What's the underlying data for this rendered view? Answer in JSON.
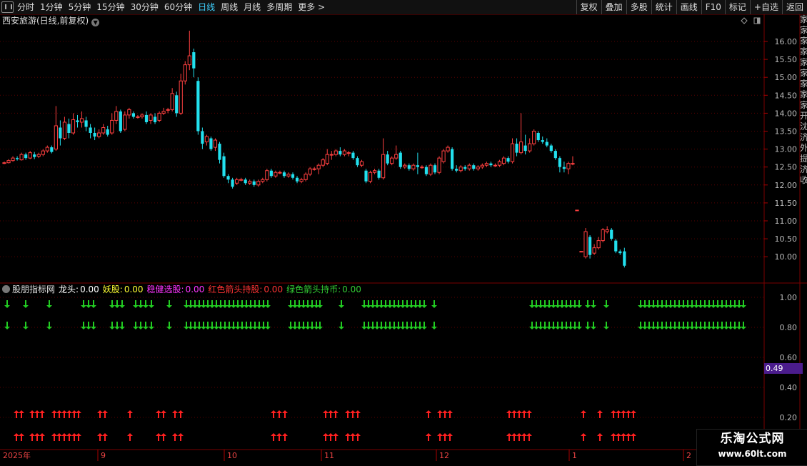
{
  "toolbar": {
    "periods": [
      "分时",
      "1分钟",
      "5分钟",
      "15分钟",
      "30分钟",
      "60分钟",
      "日线",
      "周线",
      "月线",
      "多周期",
      "更多 >"
    ],
    "active_period": "日线",
    "right_buttons": [
      "复权",
      "叠加",
      "多股",
      "统计",
      "画线",
      "F10",
      "标记",
      "+自选",
      "返回"
    ]
  },
  "main_panel": {
    "title": "西安旅游(日线,前复权)",
    "price_axis": [
      "16.00",
      "15.50",
      "15.00",
      "14.50",
      "14.00",
      "13.50",
      "13.00",
      "12.50",
      "12.00",
      "11.50",
      "11.00",
      "10.50",
      "10.00"
    ],
    "right_clipped_text": [
      "家",
      "家",
      "家",
      "家",
      "家",
      "家",
      "家",
      "家",
      "家",
      "开",
      "沈",
      "济",
      "外",
      "提",
      "济",
      "收"
    ]
  },
  "indicator_panel": {
    "name": "股朋指标网",
    "items": [
      {
        "label": "龙头:",
        "value": "0.00",
        "color": "#ffffff"
      },
      {
        "label": "妖股:",
        "value": "0.00",
        "color": "#ffff33"
      },
      {
        "label": "稳健选股:",
        "value": "0.00",
        "color": "#ff33ff"
      },
      {
        "label": "红色箭头持股:",
        "value": "0.00",
        "color": "#ff3333"
      },
      {
        "label": "绿色箭头持币:",
        "value": "0.00",
        "color": "#33cc33"
      }
    ],
    "axis": [
      "1.00",
      "0.80",
      "0.60",
      "0.40",
      "0.20"
    ],
    "current_value": "0.49"
  },
  "time_axis": [
    "2025年",
    "9",
    "10",
    "11",
    "12",
    "1",
    "2"
  ],
  "watermark": {
    "line1": "乐淘公式网",
    "line2": "www.60lt.com"
  },
  "colors": {
    "up": "#ff4040",
    "down": "#22e0ee",
    "grid": "#5a0000",
    "green_arrow": "#22cc22",
    "red_arrow": "#ff2020"
  },
  "chart_data": {
    "type": "candlestick",
    "title": "西安旅游(日线,前复权)",
    "y_range": [
      9.7,
      16.4
    ],
    "candles": [
      [
        12.6,
        12.62,
        12.58,
        12.65
      ],
      [
        12.62,
        12.68,
        12.6,
        12.72
      ],
      [
        12.68,
        12.75,
        12.65,
        12.8
      ],
      [
        12.75,
        12.72,
        12.68,
        12.8
      ],
      [
        12.7,
        12.85,
        12.68,
        12.9
      ],
      [
        12.85,
        12.75,
        12.7,
        12.9
      ],
      [
        12.75,
        12.9,
        12.72,
        12.95
      ],
      [
        12.85,
        12.78,
        12.72,
        12.92
      ],
      [
        12.8,
        12.85,
        12.75,
        12.9
      ],
      [
        12.85,
        12.95,
        12.8,
        13.0
      ],
      [
        12.95,
        13.05,
        12.9,
        13.1
      ],
      [
        13.05,
        12.92,
        12.88,
        13.1
      ],
      [
        13.0,
        13.65,
        12.95,
        14.2
      ],
      [
        13.6,
        13.3,
        13.1,
        13.8
      ],
      [
        13.3,
        13.75,
        13.25,
        13.9
      ],
      [
        13.7,
        13.45,
        13.3,
        13.85
      ],
      [
        13.45,
        13.82,
        13.4,
        14.0
      ],
      [
        13.8,
        13.75,
        13.6,
        13.95
      ],
      [
        13.75,
        13.85,
        13.6,
        14.05
      ],
      [
        13.8,
        13.62,
        13.5,
        13.9
      ],
      [
        13.6,
        13.45,
        13.3,
        13.7
      ],
      [
        13.45,
        13.35,
        13.25,
        13.6
      ],
      [
        13.35,
        13.45,
        13.3,
        13.55
      ],
      [
        13.45,
        13.6,
        13.4,
        13.7
      ],
      [
        13.55,
        13.4,
        13.35,
        13.65
      ],
      [
        13.45,
        13.8,
        13.4,
        14.0
      ],
      [
        13.8,
        14.05,
        13.7,
        14.2
      ],
      [
        14.05,
        13.5,
        13.45,
        14.1
      ],
      [
        13.55,
        13.95,
        13.5,
        14.05
      ],
      [
        13.95,
        14.1,
        13.85,
        14.15
      ],
      [
        14.0,
        13.9,
        13.85,
        14.05
      ],
      [
        13.9,
        13.9,
        13.85,
        13.95
      ],
      [
        13.9,
        13.95,
        13.85,
        14.0
      ],
      [
        13.95,
        13.75,
        13.7,
        14.05
      ],
      [
        13.8,
        13.95,
        13.7,
        14.0
      ],
      [
        13.9,
        13.75,
        13.7,
        14.0
      ],
      [
        13.8,
        14.0,
        13.75,
        14.05
      ],
      [
        14.0,
        14.05,
        13.95,
        14.15
      ],
      [
        14.1,
        14.1,
        14.0,
        14.15
      ],
      [
        14.1,
        14.55,
        14.05,
        14.7
      ],
      [
        14.5,
        14.0,
        13.9,
        14.6
      ],
      [
        14.0,
        14.9,
        13.95,
        15.1
      ],
      [
        14.9,
        15.35,
        14.8,
        15.45
      ],
      [
        15.35,
        15.6,
        15.2,
        16.3
      ],
      [
        15.7,
        15.25,
        15.0,
        15.8
      ],
      [
        14.9,
        13.5,
        13.4,
        15.0
      ],
      [
        13.5,
        13.15,
        13.0,
        13.6
      ],
      [
        13.2,
        13.35,
        13.1,
        13.4
      ],
      [
        13.3,
        13.0,
        12.95,
        13.35
      ],
      [
        13.05,
        13.25,
        12.95,
        13.3
      ],
      [
        13.15,
        12.7,
        12.6,
        13.2
      ],
      [
        12.8,
        12.25,
        12.2,
        12.9
      ],
      [
        12.25,
        12.15,
        12.05,
        12.3
      ],
      [
        12.15,
        11.95,
        11.9,
        12.2
      ],
      [
        12.05,
        12.15,
        12.0,
        12.2
      ],
      [
        12.15,
        12.15,
        12.1,
        12.2
      ],
      [
        12.15,
        12.05,
        12.0,
        12.2
      ],
      [
        12.05,
        12.1,
        12.0,
        12.15
      ],
      [
        12.1,
        12.0,
        11.95,
        12.15
      ],
      [
        12.0,
        12.1,
        11.95,
        12.15
      ],
      [
        12.1,
        12.15,
        12.05,
        12.2
      ],
      [
        12.15,
        12.4,
        12.1,
        12.45
      ],
      [
        12.4,
        12.25,
        12.2,
        12.45
      ],
      [
        12.25,
        12.35,
        12.2,
        12.4
      ],
      [
        12.35,
        12.35,
        12.3,
        12.4
      ],
      [
        12.35,
        12.25,
        12.2,
        12.4
      ],
      [
        12.25,
        12.3,
        12.2,
        12.35
      ],
      [
        12.3,
        12.2,
        12.15,
        12.35
      ],
      [
        12.2,
        12.1,
        12.05,
        12.25
      ],
      [
        12.1,
        12.15,
        12.05,
        12.2
      ],
      [
        12.15,
        12.3,
        12.1,
        12.35
      ],
      [
        12.3,
        12.45,
        12.25,
        12.5
      ],
      [
        12.45,
        12.45,
        12.4,
        12.5
      ],
      [
        12.45,
        12.55,
        12.3,
        12.6
      ],
      [
        12.55,
        12.7,
        12.5,
        12.75
      ],
      [
        12.6,
        12.85,
        12.55,
        13.0
      ],
      [
        12.85,
        12.85,
        12.7,
        12.95
      ],
      [
        12.85,
        12.95,
        12.8,
        13.0
      ],
      [
        12.95,
        12.85,
        12.8,
        13.05
      ],
      [
        12.85,
        12.95,
        12.8,
        13.0
      ],
      [
        12.9,
        12.9,
        12.8,
        12.95
      ],
      [
        12.9,
        12.75,
        12.7,
        12.95
      ],
      [
        12.75,
        12.55,
        12.5,
        12.8
      ],
      [
        12.55,
        12.65,
        12.5,
        12.7
      ],
      [
        12.4,
        12.1,
        12.05,
        12.45
      ],
      [
        12.1,
        12.35,
        12.05,
        12.4
      ],
      [
        12.35,
        12.4,
        12.3,
        12.45
      ],
      [
        12.4,
        12.2,
        12.15,
        12.45
      ],
      [
        12.2,
        12.85,
        12.15,
        13.3
      ],
      [
        12.85,
        12.6,
        12.55,
        12.95
      ],
      [
        12.6,
        12.75,
        12.55,
        12.8
      ],
      [
        12.75,
        12.85,
        12.7,
        13.1
      ],
      [
        12.9,
        12.5,
        12.45,
        12.95
      ],
      [
        12.5,
        12.55,
        12.45,
        12.6
      ],
      [
        12.55,
        12.45,
        12.4,
        12.6
      ],
      [
        12.45,
        12.55,
        12.4,
        12.6
      ],
      [
        12.55,
        12.5,
        12.3,
        12.9
      ],
      [
        12.5,
        12.5,
        12.45,
        12.55
      ],
      [
        12.5,
        12.3,
        12.25,
        12.55
      ],
      [
        12.3,
        12.55,
        12.25,
        12.6
      ],
      [
        12.55,
        12.35,
        12.3,
        12.6
      ],
      [
        12.35,
        12.75,
        12.3,
        12.8
      ],
      [
        12.65,
        12.95,
        12.6,
        13.0
      ],
      [
        12.95,
        13.05,
        12.9,
        13.1
      ],
      [
        13.0,
        12.45,
        12.4,
        13.05
      ],
      [
        12.45,
        12.4,
        12.35,
        12.55
      ],
      [
        12.4,
        12.5,
        12.35,
        12.55
      ],
      [
        12.5,
        12.45,
        12.4,
        12.55
      ],
      [
        12.45,
        12.55,
        12.4,
        12.6
      ],
      [
        12.55,
        12.45,
        12.4,
        12.6
      ],
      [
        12.45,
        12.5,
        12.4,
        12.55
      ],
      [
        12.5,
        12.55,
        12.45,
        12.6
      ],
      [
        12.55,
        12.6,
        12.5,
        12.65
      ],
      [
        12.6,
        12.55,
        12.5,
        12.65
      ],
      [
        12.55,
        12.55,
        12.5,
        12.6
      ],
      [
        12.55,
        12.65,
        12.5,
        12.7
      ],
      [
        12.6,
        12.75,
        12.55,
        12.8
      ],
      [
        12.75,
        12.65,
        12.6,
        12.8
      ],
      [
        12.65,
        13.15,
        12.6,
        13.3
      ],
      [
        13.15,
        12.9,
        12.8,
        13.3
      ],
      [
        12.9,
        13.2,
        12.85,
        14.0
      ],
      [
        13.1,
        12.95,
        12.85,
        13.4
      ],
      [
        12.95,
        13.15,
        12.9,
        13.3
      ],
      [
        13.15,
        13.5,
        13.1,
        13.55
      ],
      [
        13.45,
        13.25,
        13.2,
        13.5
      ],
      [
        13.25,
        13.2,
        13.15,
        13.35
      ],
      [
        13.2,
        13.1,
        13.05,
        13.3
      ],
      [
        13.1,
        12.95,
        12.9,
        13.15
      ],
      [
        12.95,
        12.75,
        12.7,
        13.0
      ],
      [
        12.75,
        12.5,
        12.35,
        12.8
      ],
      [
        12.5,
        12.45,
        12.35,
        12.65
      ],
      [
        12.45,
        12.6,
        12.3,
        12.65
      ],
      [
        12.6,
        12.6,
        12.55,
        12.8
      ],
      [
        11.3,
        11.3,
        11.3,
        11.3
      ],
      [
        10.15,
        10.15,
        10.15,
        10.15
      ],
      [
        10.0,
        10.7,
        9.95,
        10.8
      ],
      [
        10.55,
        10.05,
        9.95,
        10.6
      ],
      [
        10.1,
        10.25,
        10.05,
        10.35
      ],
      [
        10.25,
        10.45,
        10.2,
        10.55
      ],
      [
        10.45,
        10.75,
        10.4,
        10.8
      ],
      [
        10.7,
        10.75,
        10.65,
        10.85
      ],
      [
        10.75,
        10.5,
        10.45,
        10.8
      ],
      [
        10.45,
        10.15,
        10.1,
        10.5
      ],
      [
        10.15,
        10.1,
        10.05,
        10.2
      ],
      [
        10.15,
        9.75,
        9.7,
        10.25
      ]
    ]
  }
}
